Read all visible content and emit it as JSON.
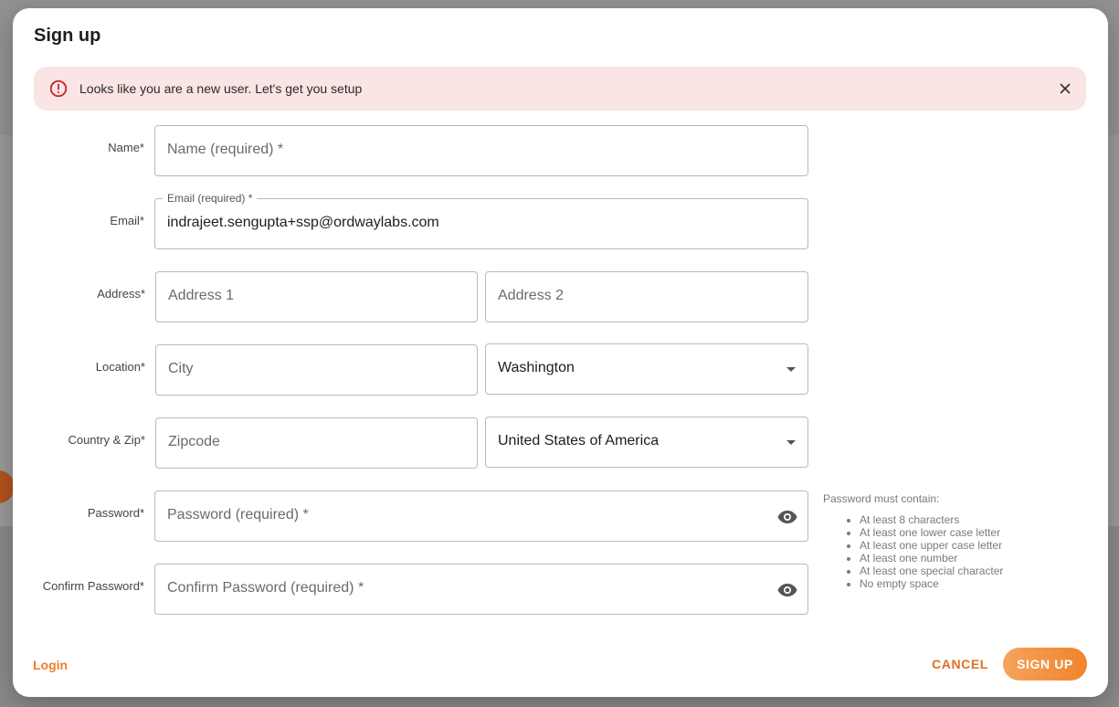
{
  "modal": {
    "title": "Sign up"
  },
  "alert": {
    "message": "Looks like you are a new user. Let's get you setup",
    "icon": "error-circle-icon",
    "close_icon": "close-icon",
    "color": "#fbe4e4"
  },
  "form": {
    "name": {
      "label": "Name*",
      "placeholder": "Name (required) *",
      "value": ""
    },
    "email": {
      "label": "Email*",
      "floating_label": "Email (required) *",
      "value": "indrajeet.sengupta+ssp@ordwaylabs.com"
    },
    "address": {
      "label": "Address*",
      "address1_placeholder": "Address 1",
      "address2_placeholder": "Address 2"
    },
    "location": {
      "label": "Location*",
      "city_placeholder": "City",
      "state_value": "Washington"
    },
    "country_zip": {
      "label": "Country & Zip*",
      "zip_placeholder": "Zipcode",
      "country_value": "United States of America"
    },
    "password": {
      "label": "Password*",
      "placeholder": "Password (required) *"
    },
    "confirm_password": {
      "label": "Confirm Password*",
      "placeholder": "Confirm Password (required) *"
    }
  },
  "password_rules": {
    "heading": "Password must contain:",
    "items": [
      "At least 8 characters",
      "At least one lower case letter",
      "At least one upper case letter",
      "At least one number",
      "At least one special character",
      "No empty space"
    ]
  },
  "footer": {
    "login_label": "Login",
    "cancel_label": "CANCEL",
    "signup_label": "SIGN UP",
    "accent_color": "#f07c26"
  }
}
